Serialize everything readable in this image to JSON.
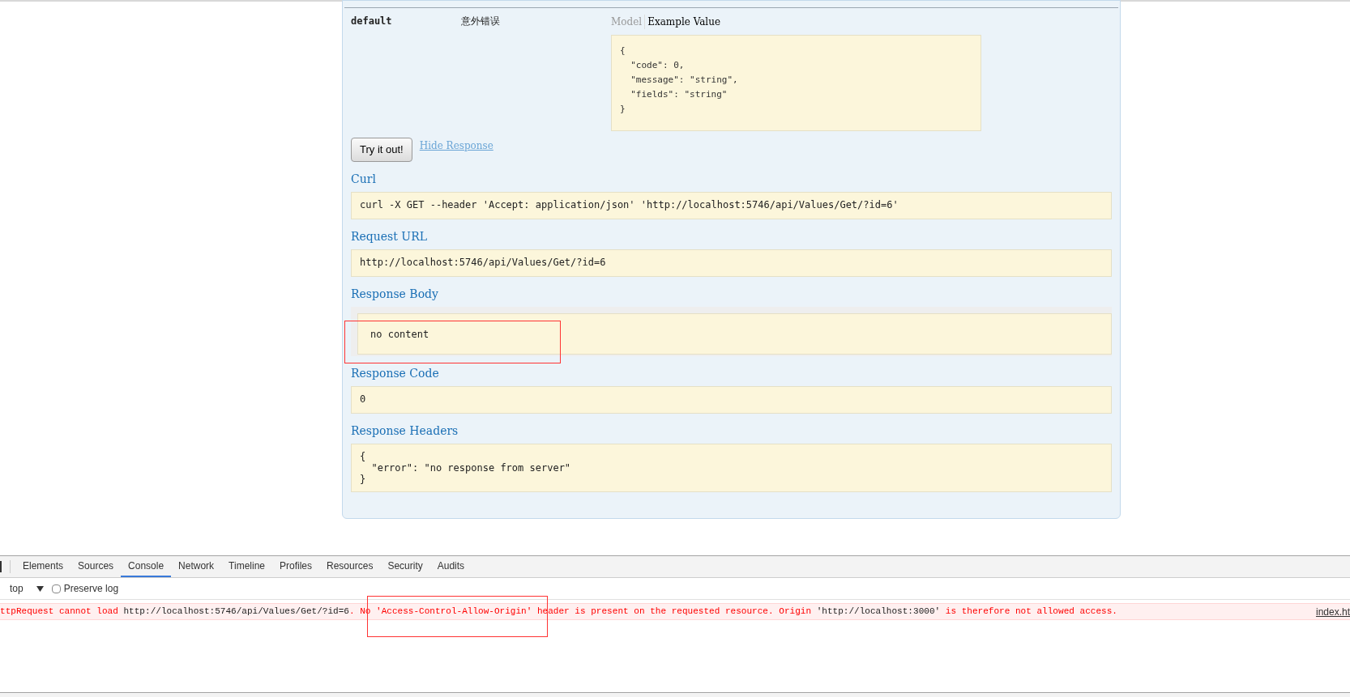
{
  "response_row": {
    "code": "default",
    "description": "意外错误",
    "tabs": [
      {
        "label": "Model",
        "selected": false
      },
      {
        "label": "Example Value",
        "selected": true
      }
    ],
    "example_lines": [
      "{",
      "  \"code\": 0,",
      "  \"message\": \"string\",",
      "  \"fields\": \"string\"",
      "}"
    ]
  },
  "try_button": "Try it out!",
  "hide_link": "Hide Response",
  "sections": [
    {
      "title": "Curl",
      "kind": "text",
      "lines": [
        "curl -X GET --header 'Accept: application/json' 'http://localhost:5746/api/Values/Get/?id=6'"
      ]
    },
    {
      "title": "Request URL",
      "kind": "text",
      "lines": [
        "http://localhost:5746/api/Values/Get/?id=6"
      ]
    },
    {
      "title": "Response Body",
      "kind": "body",
      "lines": [
        "no content"
      ]
    },
    {
      "title": "Response Code",
      "kind": "text",
      "lines": [
        "0"
      ]
    },
    {
      "title": "Response Headers",
      "kind": "text",
      "lines": [
        "{",
        "  \"error\": \"no response from server\"",
        "}"
      ]
    }
  ],
  "devtools": {
    "tabs": [
      {
        "label": "Elements",
        "selected": false
      },
      {
        "label": "Sources",
        "selected": false
      },
      {
        "label": "Console",
        "selected": true
      },
      {
        "label": "Network",
        "selected": false
      },
      {
        "label": "Timeline",
        "selected": false
      },
      {
        "label": "Profiles",
        "selected": false
      },
      {
        "label": "Resources",
        "selected": false
      },
      {
        "label": "Security",
        "selected": false
      },
      {
        "label": "Audits",
        "selected": false
      }
    ],
    "context": "top",
    "preserve_log": {
      "label": "Preserve log",
      "checked": false
    },
    "error": {
      "parts": [
        {
          "kind": "text",
          "text": "ttpRequest cannot load "
        },
        {
          "kind": "url",
          "text": "http://localhost:5746/api/Values/Get/?id=6"
        },
        {
          "kind": "text",
          "text": ". No 'Access-Control-Allow-Origin' header is present on the requested resource. Origin "
        },
        {
          "kind": "url",
          "text": "'http://localhost:3000'"
        },
        {
          "kind": "text",
          "text": " is therefore not allowed access."
        }
      ],
      "source": "index.ht"
    }
  }
}
